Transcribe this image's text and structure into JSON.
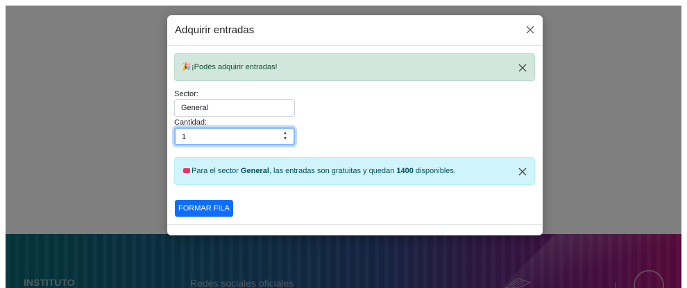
{
  "footer": {
    "title": "INSTITUTO",
    "social_label": "Redes sociales oficiales"
  },
  "modal": {
    "title": "Adquirir entradas",
    "success_alert": {
      "icon": "party-popper-icon",
      "emoji": "🎉",
      "text": "¡Podés adquirir entradas!"
    },
    "sector_label": "Sector:",
    "sector_value": "General",
    "cantidad_label": "Cantidad:",
    "cantidad_value": "1",
    "info_alert": {
      "icon": "ticket-icon",
      "prefix": "Para el sector ",
      "sector": "General",
      "middle": ", las entradas son gratuitas y quedan ",
      "count": "1400",
      "suffix": " disponibles."
    },
    "submit_label": "FORMAR FILA"
  },
  "colors": {
    "primary": "#0d6efd",
    "success_bg": "#d1e7dd",
    "info_bg": "#cff4fc",
    "ticket": "#e8336a"
  }
}
